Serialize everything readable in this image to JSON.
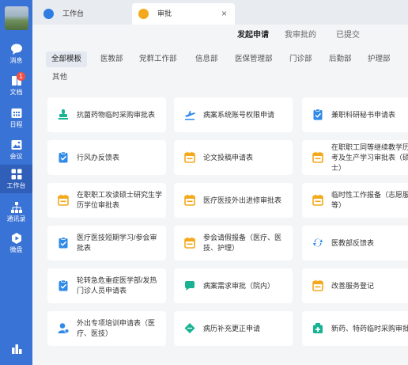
{
  "rail": {
    "items": [
      {
        "label": "消息",
        "icon": "chat-bubble-icon"
      },
      {
        "label": "文档",
        "icon": "document-icon",
        "badge": "1"
      },
      {
        "label": "日程",
        "icon": "calendar-icon"
      },
      {
        "label": "会议",
        "icon": "meeting-icon"
      },
      {
        "label": "工作台",
        "icon": "grid-icon"
      },
      {
        "label": "通讯录",
        "icon": "contacts-icon"
      },
      {
        "label": "微盘",
        "icon": "cloud-disk-icon"
      }
    ],
    "bottom_icon": "apps-icon",
    "accent": "#3a73d6"
  },
  "tabs": [
    {
      "label": "工作台",
      "icon": "workbench-icon"
    },
    {
      "label": "审批",
      "icon": "approval-icon",
      "close": "×"
    }
  ],
  "segments": [
    "发起申请",
    "我审批的",
    "已提交"
  ],
  "categories": [
    "全部模板",
    "医教部",
    "党群工作部",
    "信息部",
    "医保管理部",
    "门诊部",
    "后勤部",
    "护理部",
    "其他"
  ],
  "cards": [
    {
      "label": "抗菌药物临时采购审批表",
      "icon": "stamp-icon",
      "color": "#19b394"
    },
    {
      "label": "病案系统账号权限申请",
      "icon": "airplane-icon",
      "color": "#2f8ae8"
    },
    {
      "label": "兼职科研秘书申请表",
      "icon": "clipboard-check-icon",
      "color": "#2f8ae8"
    },
    {
      "label": "行风办反馈表",
      "icon": "clipboard-check-icon",
      "color": "#2f8ae8"
    },
    {
      "label": "论文投稿申请表",
      "icon": "calendar-icon",
      "color": "#f3a91b"
    },
    {
      "label": "在职职工同等继续教学历报考及生产学习审批表（硕士）",
      "icon": "calendar-icon",
      "color": "#f3a91b"
    },
    {
      "label": "在职职工攻读硕士研究生学历学位审批表",
      "icon": "calendar-icon",
      "color": "#f3a91b"
    },
    {
      "label": "医疗医技外出进修审批表",
      "icon": "calendar-icon",
      "color": "#f3a91b"
    },
    {
      "label": "临时性工作报备（志愿服务等）",
      "icon": "calendar-icon",
      "color": "#f3a91b"
    },
    {
      "label": "医疗医技短期学习/参会审批表",
      "icon": "clipboard-check-icon",
      "color": "#2f8ae8"
    },
    {
      "label": "参会请假报备（医疗、医技、护理）",
      "icon": "calendar-icon",
      "color": "#f3a91b"
    },
    {
      "label": "医教部反馈表",
      "icon": "refresh-icon",
      "color": "#2f8ae8"
    },
    {
      "label": "轮转急危重症医学部/发热门诊人员申请表",
      "icon": "clipboard-check-icon",
      "color": "#2f8ae8"
    },
    {
      "label": "病案需求审批（院内）",
      "icon": "chat-icon",
      "color": "#19b394"
    },
    {
      "label": "改善服务登记",
      "icon": "calendar-icon",
      "color": "#f3a91b"
    },
    {
      "label": "外出专项培训申请表（医疗、医技）",
      "icon": "person-icon",
      "color": "#2f8ae8"
    },
    {
      "label": "病历补充更正申请",
      "icon": "diamond-icon",
      "color": "#19b394"
    },
    {
      "label": "新药、特药临时采购审批表",
      "icon": "medicine-icon",
      "color": "#19b394"
    }
  ]
}
